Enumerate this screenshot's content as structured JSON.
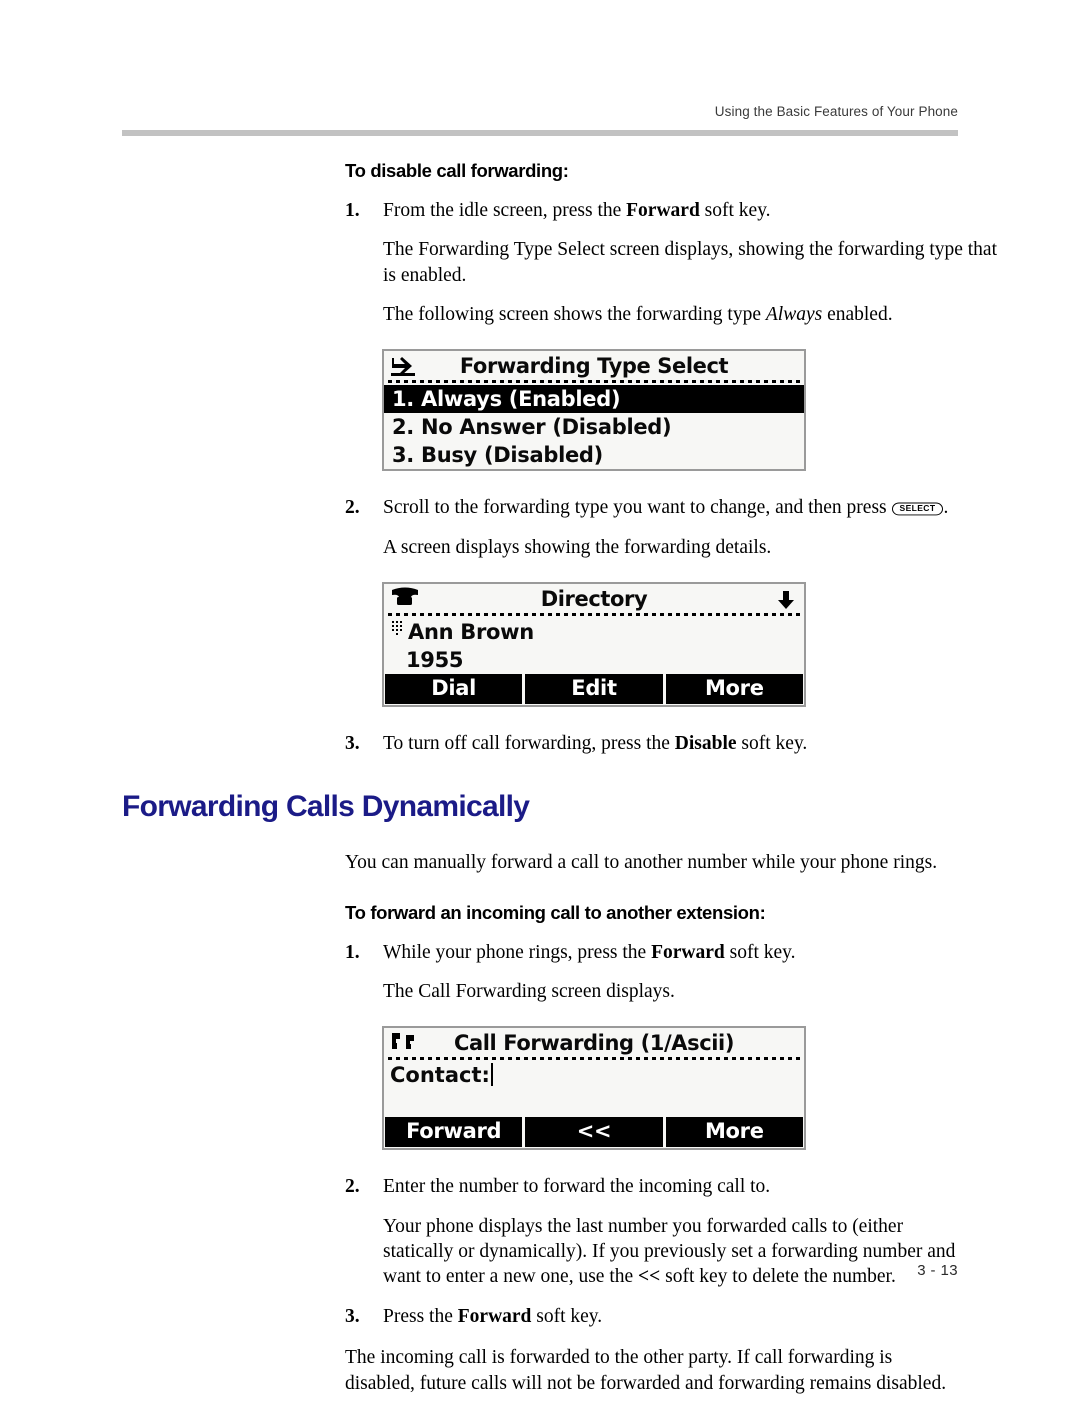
{
  "header": {
    "running_head": "Using the Basic Features of Your Phone"
  },
  "footer": {
    "page_number": "3 - 13"
  },
  "colors": {
    "heading_blue": "#1b1b87",
    "rule_gray": "#c2c2c2",
    "lcd_background": "#f7f7f5",
    "lcd_border": "#9a9a9a",
    "lcd_selected_bg": "#000000"
  },
  "sections": {
    "disable_forwarding": {
      "heading": "To disable call forwarding:",
      "step1": {
        "num": "1.",
        "text_before": "From the idle screen, press the ",
        "bold": "Forward",
        "text_after": " soft key."
      },
      "para1": "The Forwarding Type Select screen displays, showing the forwarding type that is enabled.",
      "para2_before": "The following screen shows the forwarding type ",
      "para2_italic": "Always",
      "para2_after": " enabled.",
      "step2": {
        "num": "2.",
        "text_before": "Scroll to the forwarding type you want to change, and then press ",
        "hardkey": "SELECT",
        "text_after": "."
      },
      "para3": "A screen displays showing the forwarding details.",
      "step3": {
        "num": "3.",
        "text_before": "To turn off call forwarding, press the ",
        "bold": "Disable",
        "text_after": " soft key."
      }
    },
    "dynamic_forwarding": {
      "heading": "Forwarding Calls Dynamically",
      "intro": "You can manually forward a call to another number while your phone rings.",
      "subheading": "To forward an incoming call to another extension:",
      "step1": {
        "num": "1.",
        "text_before": "While your phone rings, press the ",
        "bold": "Forward",
        "text_after": " soft key."
      },
      "para1": "The Call Forwarding screen displays.",
      "step2": {
        "num": "2.",
        "text": "Enter the number to forward the incoming call to."
      },
      "para2_before": "Your phone displays the last number you forwarded calls to (either statically or dynamically). If you previously set a forwarding number and want to enter a new one, use the ",
      "para2_bold": "<<",
      "para2_after": " soft key to delete the number.",
      "step3": {
        "num": "3.",
        "text_before": "Press the ",
        "bold": "Forward",
        "text_after": " soft key."
      },
      "para3": "The incoming call is forwarded to the other party. If call forwarding is disabled, future calls will not be forwarded and forwarding remains disabled."
    }
  },
  "lcd_screens": [
    {
      "id": "forwarding-type-select",
      "icon": "call-forward-arrow-icon",
      "title": "Forwarding Type Select",
      "rows": [
        {
          "label": "1. Always (Enabled)",
          "selected": true
        },
        {
          "label": "2. No Answer (Disabled)",
          "selected": false
        },
        {
          "label": "3. Busy (Disabled)",
          "selected": false
        }
      ],
      "softkeys": []
    },
    {
      "id": "directory",
      "icon": "handset-icon",
      "right_icon": "arrow-down-icon",
      "title": "Directory",
      "entry_icon": "keypad-icon",
      "contact_name": "Ann Brown",
      "contact_number": "1955",
      "softkeys": [
        "Dial",
        "Edit",
        "More"
      ]
    },
    {
      "id": "call-forwarding",
      "icon": "ringing-notes-icon",
      "title": "Call Forwarding (1/Ascii)",
      "field_label": "Contact:",
      "field_value": "",
      "softkeys": [
        "Forward",
        "<<",
        "More"
      ]
    }
  ]
}
